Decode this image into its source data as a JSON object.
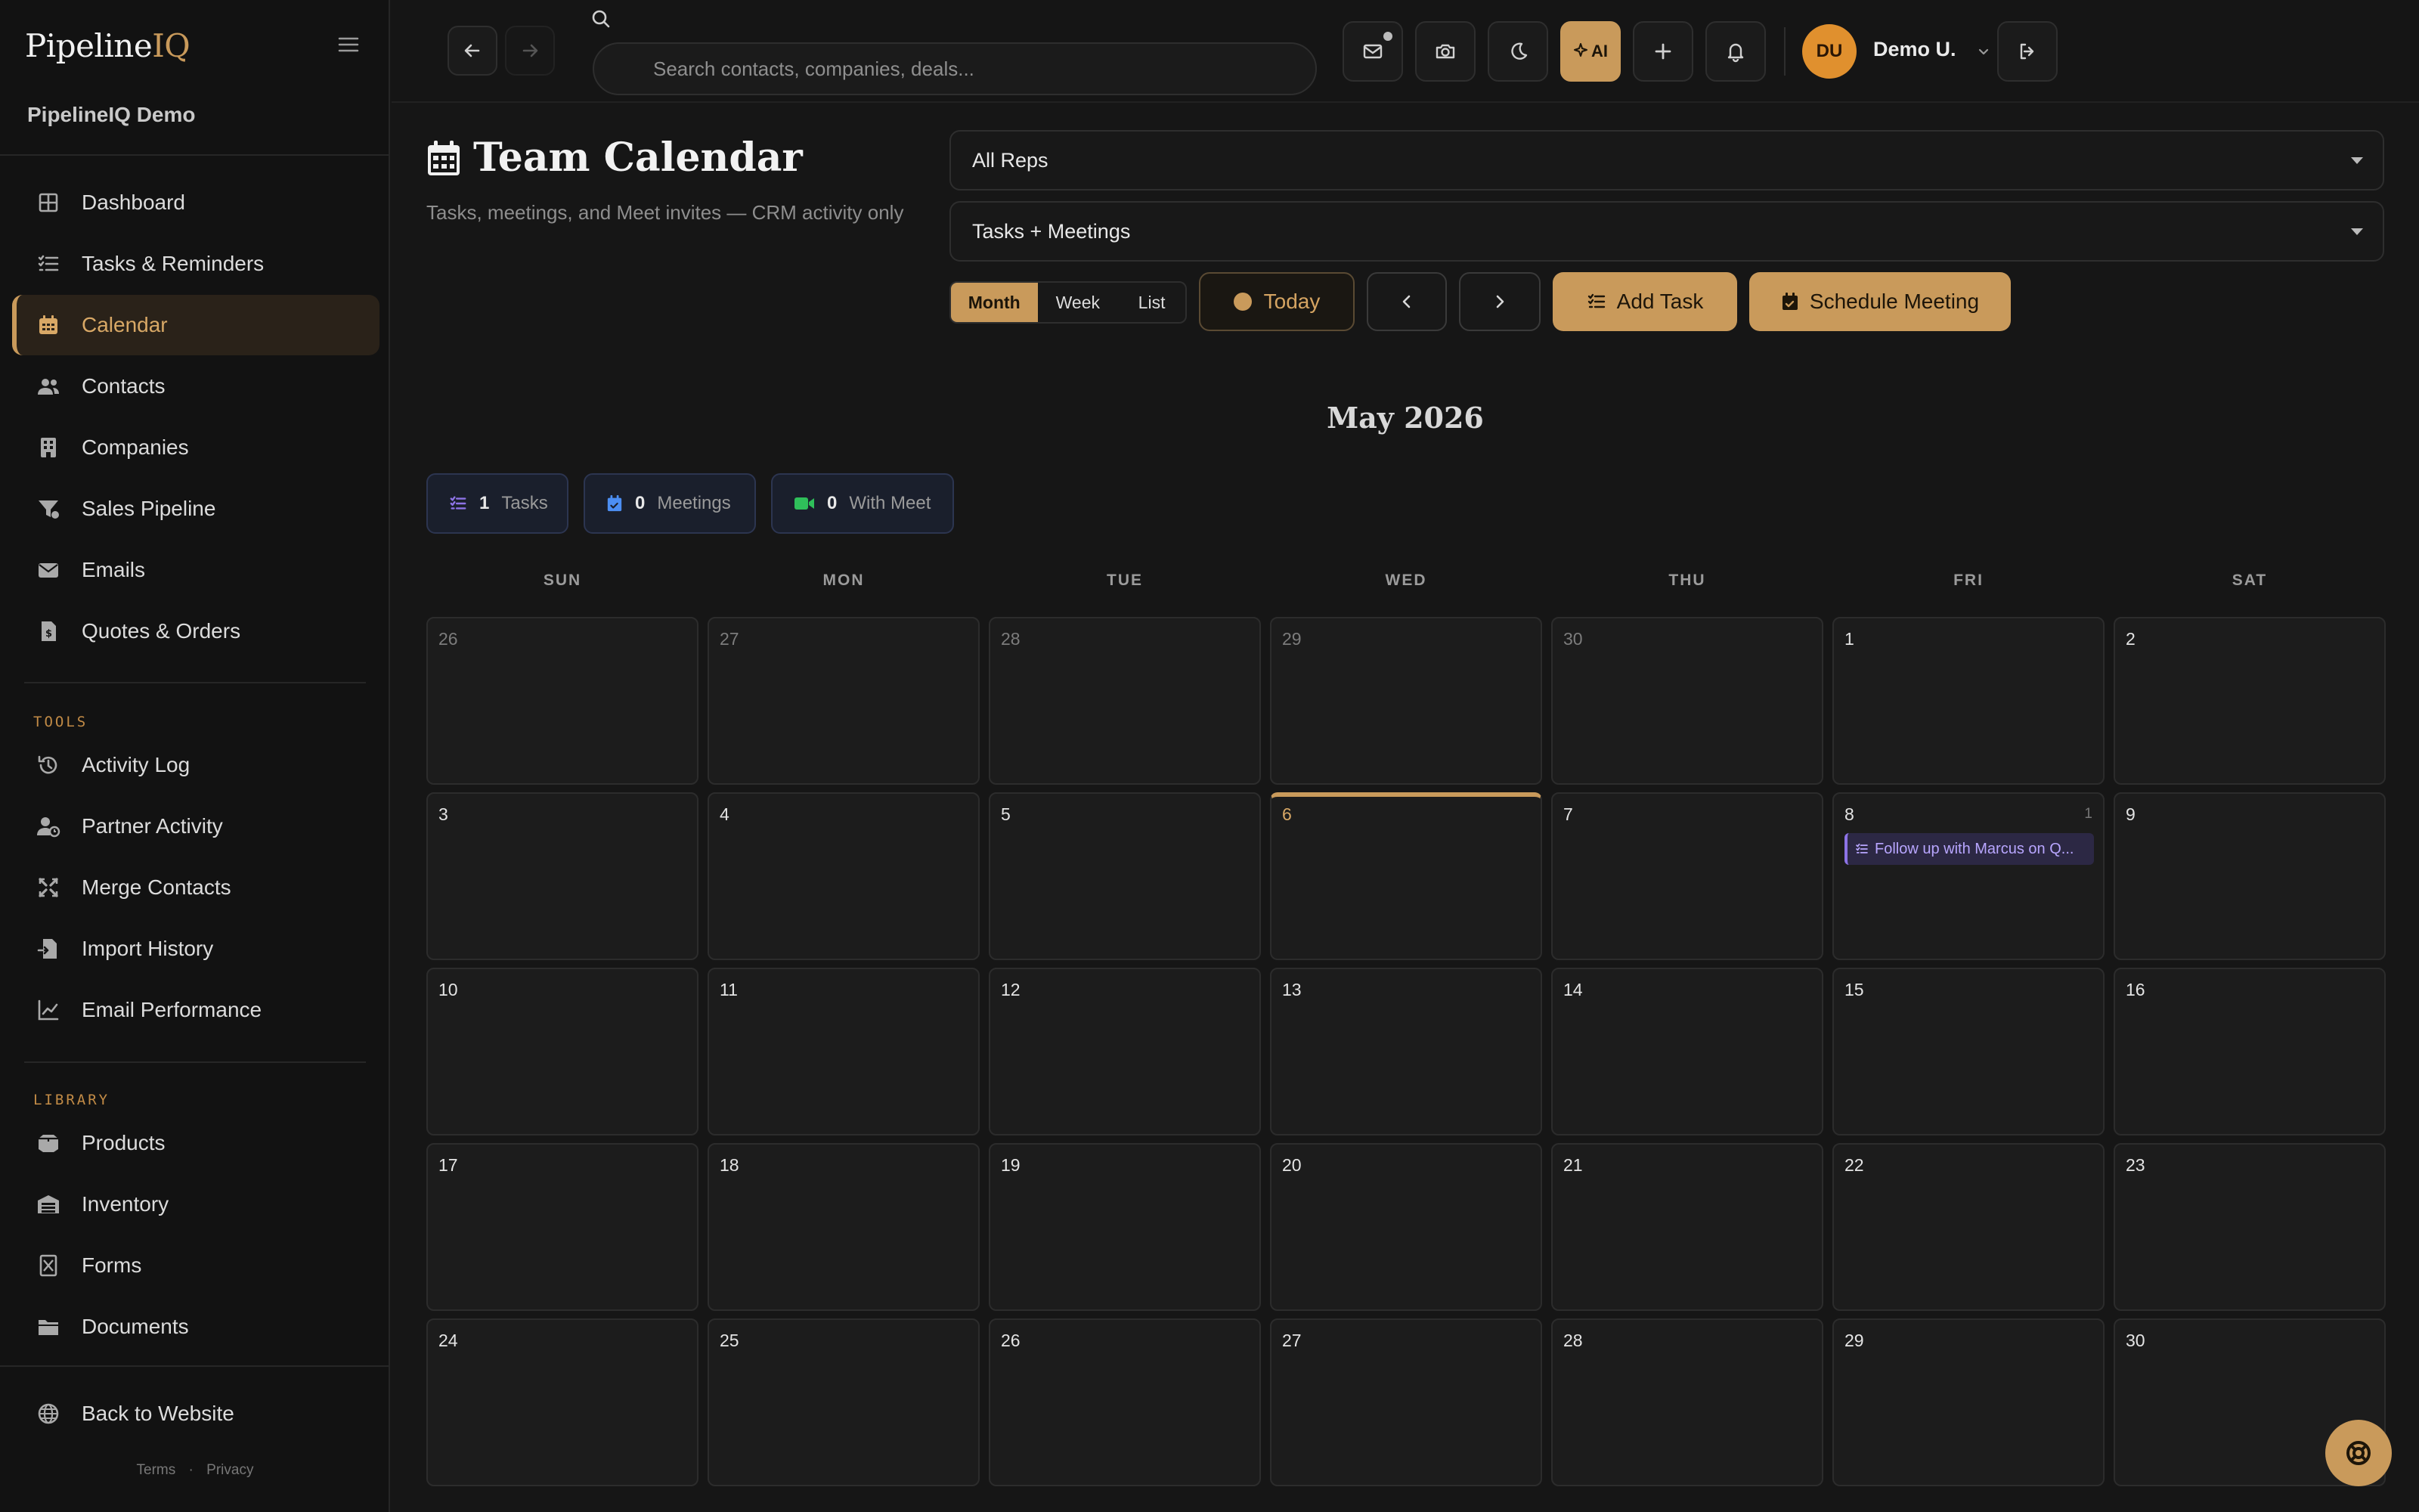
{
  "sidebar": {
    "brand_prefix": "Pipeline",
    "brand_suffix": "IQ",
    "workspace": "PipelineIQ Demo",
    "main_items": [
      {
        "label": "Dashboard",
        "icon": "dashboard-icon"
      },
      {
        "label": "Tasks & Reminders",
        "icon": "tasks-icon"
      },
      {
        "label": "Calendar",
        "icon": "calendar-icon",
        "active": true
      },
      {
        "label": "Contacts",
        "icon": "contacts-icon"
      },
      {
        "label": "Companies",
        "icon": "building-icon"
      },
      {
        "label": "Sales Pipeline",
        "icon": "funnel-icon"
      },
      {
        "label": "Emails",
        "icon": "envelope-icon"
      },
      {
        "label": "Quotes & Orders",
        "icon": "invoice-icon"
      }
    ],
    "tools_label": "TOOLS",
    "tools_items": [
      {
        "label": "Activity Log",
        "icon": "history-icon"
      },
      {
        "label": "Partner Activity",
        "icon": "user-clock-icon"
      },
      {
        "label": "Merge Contacts",
        "icon": "merge-icon"
      },
      {
        "label": "Import History",
        "icon": "file-import-icon"
      },
      {
        "label": "Email Performance",
        "icon": "chart-line-icon"
      }
    ],
    "library_label": "LIBRARY",
    "library_items": [
      {
        "label": "Products",
        "icon": "box-icon"
      },
      {
        "label": "Inventory",
        "icon": "warehouse-icon"
      },
      {
        "label": "Forms",
        "icon": "form-icon"
      },
      {
        "label": "Documents",
        "icon": "folder-icon"
      }
    ],
    "back_label": "Back to Website",
    "terms": "Terms",
    "sep": "·",
    "privacy": "Privacy"
  },
  "topbar": {
    "search_placeholder": "Search contacts, companies, deals...",
    "ai_label": "AI",
    "user_initials": "DU",
    "user_name": "Demo U."
  },
  "page": {
    "title": "Team Calendar",
    "subtitle": "Tasks, meetings, and Meet invites — CRM activity only",
    "rep_filter": "All Reps",
    "type_filter": "Tasks + Meetings",
    "views": [
      "Month",
      "Week",
      "List"
    ],
    "active_view": "Month",
    "today_label": "Today",
    "add_task_label": "Add Task",
    "schedule_label": "Schedule Meeting",
    "month_title": "May 2026",
    "stats": [
      {
        "count": "1",
        "label": "Tasks",
        "color": "#8d73e6"
      },
      {
        "count": "0",
        "label": "Meetings",
        "color": "#4c8ef2"
      },
      {
        "count": "0",
        "label": "With Meet",
        "color": "#2fbf5a"
      }
    ]
  },
  "calendar": {
    "weekdays": [
      "SUN",
      "MON",
      "TUE",
      "WED",
      "THU",
      "FRI",
      "SAT"
    ],
    "weeks": [
      [
        {
          "d": "26",
          "out": true
        },
        {
          "d": "27",
          "out": true
        },
        {
          "d": "28",
          "out": true
        },
        {
          "d": "29",
          "out": true
        },
        {
          "d": "30",
          "out": true
        },
        {
          "d": "1"
        },
        {
          "d": "2"
        }
      ],
      [
        {
          "d": "3"
        },
        {
          "d": "4"
        },
        {
          "d": "5"
        },
        {
          "d": "6",
          "today": true
        },
        {
          "d": "7"
        },
        {
          "d": "8",
          "count": "1",
          "events": [
            "Follow up with Marcus on Q..."
          ]
        },
        {
          "d": "9"
        }
      ],
      [
        {
          "d": "10"
        },
        {
          "d": "11"
        },
        {
          "d": "12"
        },
        {
          "d": "13"
        },
        {
          "d": "14"
        },
        {
          "d": "15"
        },
        {
          "d": "16"
        }
      ],
      [
        {
          "d": "17"
        },
        {
          "d": "18"
        },
        {
          "d": "19"
        },
        {
          "d": "20"
        },
        {
          "d": "21"
        },
        {
          "d": "22"
        },
        {
          "d": "23"
        }
      ],
      [
        {
          "d": "24"
        },
        {
          "d": "25"
        },
        {
          "d": "26"
        },
        {
          "d": "27"
        },
        {
          "d": "28"
        },
        {
          "d": "29"
        },
        {
          "d": "30"
        }
      ]
    ]
  },
  "colors": {
    "accent": "#c99a5b",
    "background": "#161616",
    "task_event": "#8d73e6"
  }
}
